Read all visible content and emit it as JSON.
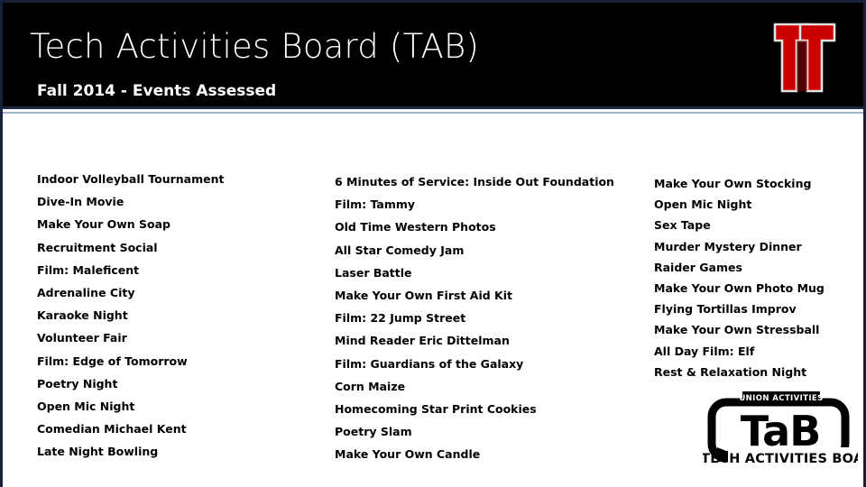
{
  "header": {
    "title": "Tech Activities Board (TAB)",
    "subtitle": "Fall 2014 - Events Assessed",
    "background_color": "#000000",
    "text_color": "#ffffff",
    "border_color": "#1d2840",
    "underline_color": "#9fb4cc"
  },
  "university_logo": {
    "name": "Texas Tech Double T",
    "primary_color": "#cc0000",
    "outline_color": "#d8d8d8",
    "background_color": "#000000"
  },
  "columns": [
    {
      "id": "column-1",
      "items": [
        "Indoor Volleyball Tournament",
        "Dive-In Movie",
        "Make Your Own Soap",
        "Recruitment Social",
        "Film: Maleficent",
        "Adrenaline City",
        "Karaoke Night",
        "Volunteer Fair",
        "Film: Edge of Tomorrow",
        "Poetry Night",
        "Open Mic Night",
        "Comedian Michael Kent",
        "Late Night Bowling"
      ]
    },
    {
      "id": "column-2",
      "items": [
        "6 Minutes of Service: Inside Out Foundation",
        "Film: Tammy",
        "Old Time Western Photos",
        "All Star Comedy Jam",
        "Laser Battle",
        "Make Your Own First Aid Kit",
        "Film: 22 Jump Street",
        "Mind Reader Eric Dittelman",
        "Film: Guardians of the Galaxy",
        "Corn Maize",
        "Homecoming Star Print Cookies",
        "Poetry Slam",
        "Make Your Own Candle"
      ]
    },
    {
      "id": "column-3",
      "items": [
        "Make Your Own Stocking",
        "Open Mic Night",
        "Sex Tape",
        "Murder Mystery Dinner",
        "Raider Games",
        "Make Your Own Photo Mug",
        "Flying Tortillas Improv",
        "Make Your Own Stressball",
        "All Day Film: Elf",
        "Rest & Relaxation Night"
      ]
    }
  ],
  "tab_logo": {
    "top_banner": "UNION ACTIVITIES",
    "wordmark": "TaB",
    "bottom_text": "TECH ACTIVITIES BOARD",
    "color": "#000000"
  }
}
